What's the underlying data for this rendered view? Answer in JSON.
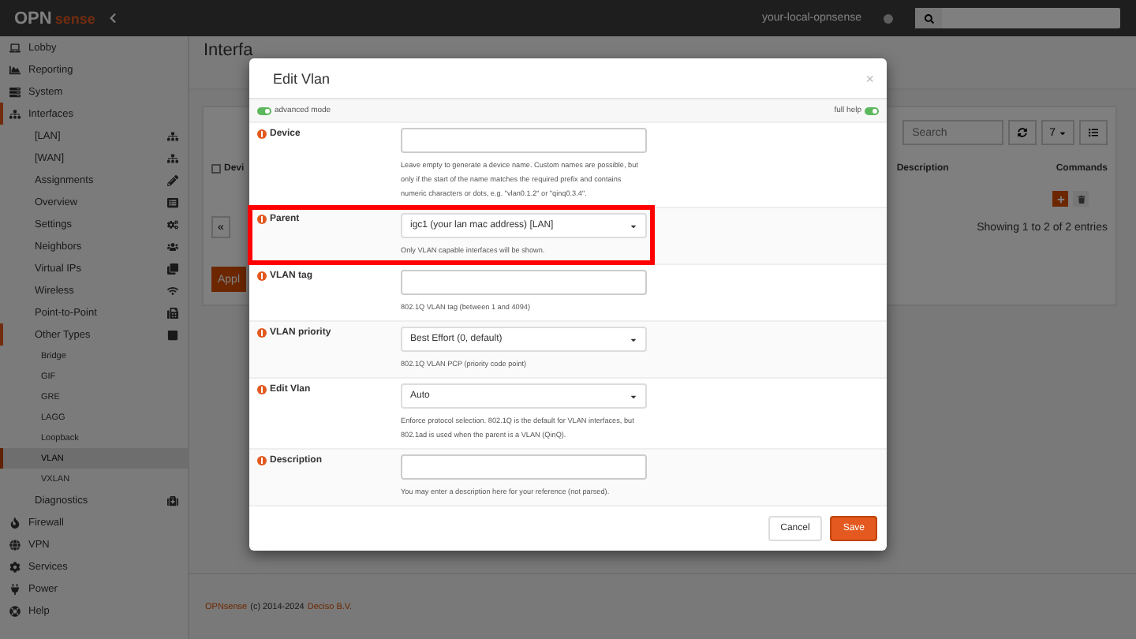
{
  "topbar": {
    "logo": {
      "text": "OPN",
      "suffix": "sense"
    },
    "hostname": "your-local-opnsense"
  },
  "sidebar": {
    "items": [
      {
        "label": "Lobby",
        "expanded": false,
        "selected": false
      },
      {
        "label": "Reporting",
        "expanded": false,
        "selected": false
      },
      {
        "label": "System",
        "expanded": false,
        "selected": false
      },
      {
        "label": "Interfaces",
        "expanded": true,
        "selected": false,
        "children": [
          {
            "label": "[LAN]",
            "selected": false
          },
          {
            "label": "[WAN]",
            "selected": false
          },
          {
            "label": "Assignments",
            "selected": false
          },
          {
            "label": "Overview",
            "selected": false
          },
          {
            "label": "Settings",
            "selected": false
          },
          {
            "label": "Neighbors",
            "selected": false
          },
          {
            "label": "Virtual IPs",
            "selected": false
          },
          {
            "label": "Wireless",
            "selected": false
          },
          {
            "label": "Point-to-Point",
            "selected": false
          },
          {
            "label": "Other Types",
            "expanded": true,
            "selected": false,
            "children": [
              {
                "label": "Bridge",
                "selected": false
              },
              {
                "label": "GIF",
                "selected": false
              },
              {
                "label": "GRE",
                "selected": false
              },
              {
                "label": "LAGG",
                "selected": false
              },
              {
                "label": "Loopback",
                "selected": false
              },
              {
                "label": "VLAN",
                "selected": true
              },
              {
                "label": "VXLAN",
                "selected": false
              }
            ]
          },
          {
            "label": "Diagnostics",
            "selected": false
          }
        ]
      },
      {
        "label": "Firewall",
        "expanded": false,
        "selected": false
      },
      {
        "label": "VPN",
        "expanded": false,
        "selected": false
      },
      {
        "label": "Services",
        "expanded": false,
        "selected": false
      },
      {
        "label": "Power",
        "expanded": false,
        "selected": false
      },
      {
        "label": "Help",
        "expanded": false,
        "selected": false
      }
    ]
  },
  "page": {
    "heading": "Interfa",
    "search": {
      "placeholder": "Search"
    },
    "page_size": "7",
    "select_all": {
      "checked": false
    },
    "columns": [
      "Devi",
      "Description",
      "Commands"
    ],
    "pager": "«",
    "info": "Showing 1 to 2 of 2 entries",
    "apply": "Appl"
  },
  "footer": {
    "brand": "OPNsense",
    "text": "(c) 2014-2024",
    "company": "Deciso B.V."
  },
  "dialog": {
    "title": "Edit Vlan",
    "close": "×",
    "toggles": [
      {
        "label": "advanced mode",
        "on": true
      },
      {
        "label": "full help",
        "on": true
      }
    ],
    "fields": [
      {
        "label": "Device",
        "kind": "text",
        "help": "Leave empty to generate a device name. Custom names are possible, but only if the start of the name matches the required prefix and contains numeric characters or dots, e.g. \"vlan0.1.2\" or \"qinq0.3.4\".",
        "highlighted": false
      },
      {
        "label": "Parent",
        "kind": "select",
        "value": "igc1 (your lan mac address) [LAN]",
        "help": "Only VLAN capable interfaces will be shown.",
        "highlighted": true
      },
      {
        "label": "VLAN tag",
        "kind": "text",
        "help": "802.1Q VLAN tag (between 1 and 4094)",
        "highlighted": false
      },
      {
        "label": "VLAN priority",
        "kind": "select",
        "value": "Best Effort (0, default)",
        "help": "802.1Q VLAN PCP (priority code point)",
        "highlighted": false
      },
      {
        "label": "Edit Vlan",
        "kind": "select",
        "value": "Auto",
        "help": "Enforce protocol selection. 802.1Q is the default for VLAN interfaces, but 802.1ad is used when the parent is a VLAN (QinQ).",
        "highlighted": false
      },
      {
        "label": "Description",
        "kind": "text",
        "help": "You may enter a description here for your reference (not parsed).",
        "highlighted": false
      }
    ],
    "buttons": [
      {
        "label": "Cancel",
        "kind": "default"
      },
      {
        "label": "Save",
        "kind": "primary"
      }
    ]
  }
}
